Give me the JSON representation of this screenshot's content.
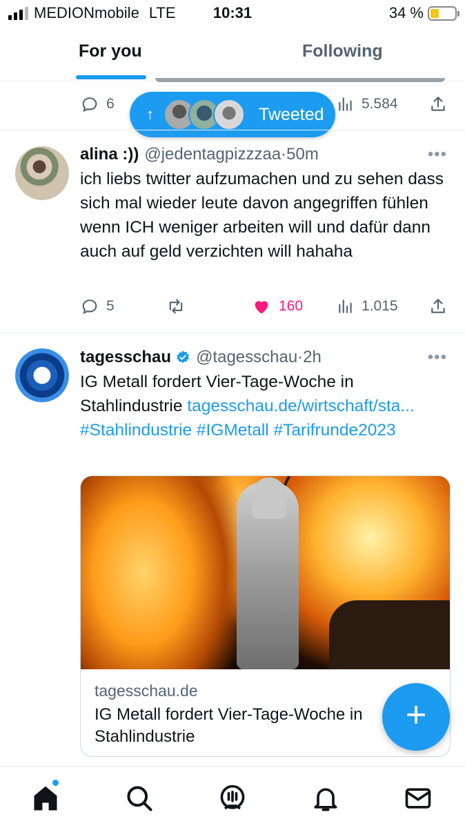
{
  "status_bar": {
    "carrier": "MEDIONmobile",
    "network": "LTE",
    "time": "10:31",
    "battery_percent": "34 %",
    "battery_level": 0.34
  },
  "tabs": [
    {
      "label": "For you",
      "active": true
    },
    {
      "label": "Following",
      "active": false
    }
  ],
  "previous_tweet": {
    "replies": "6",
    "views": "5.584"
  },
  "tweeted_pill": {
    "arrow": "↑",
    "label": "Tweeted"
  },
  "tweets": [
    {
      "name": "alina :))",
      "handle": "@jedentagpizzzaa",
      "time": "·50m",
      "more": "•••",
      "text": "ich liebs twitter aufzumachen und zu sehen dass sich mal wieder leute davon angegriffen fühlen wenn ICH weniger arbeiten will und dafür dann auch auf geld verzichten will hahaha",
      "replies": "5",
      "likes": "160",
      "views": "1.015",
      "liked": true
    },
    {
      "name": "tagesschau",
      "handle": "@tagesschau",
      "time": "·2h",
      "more": "•••",
      "verified": true,
      "text": "IG Metall fordert Vier-Tage-Woche in Stahlindustrie",
      "link": "tagesschau.de/wirtschaft/sta...",
      "hashtags": [
        "#Stahlindustrie",
        "#IGMetall",
        "#Tarifrunde2023"
      ],
      "card": {
        "domain": "tagesschau.de",
        "title": "IG Metall fordert Vier-Tage-Woche in Stahlindustrie"
      }
    }
  ],
  "fab": {
    "label": "+"
  },
  "colors": {
    "accent": "#1d9bf0",
    "like": "#f91880",
    "secondary_text": "#536471",
    "battery": "#f5c518"
  },
  "bottom_nav": [
    "home-icon",
    "search-icon",
    "spaces-icon",
    "notifications-icon",
    "messages-icon"
  ]
}
